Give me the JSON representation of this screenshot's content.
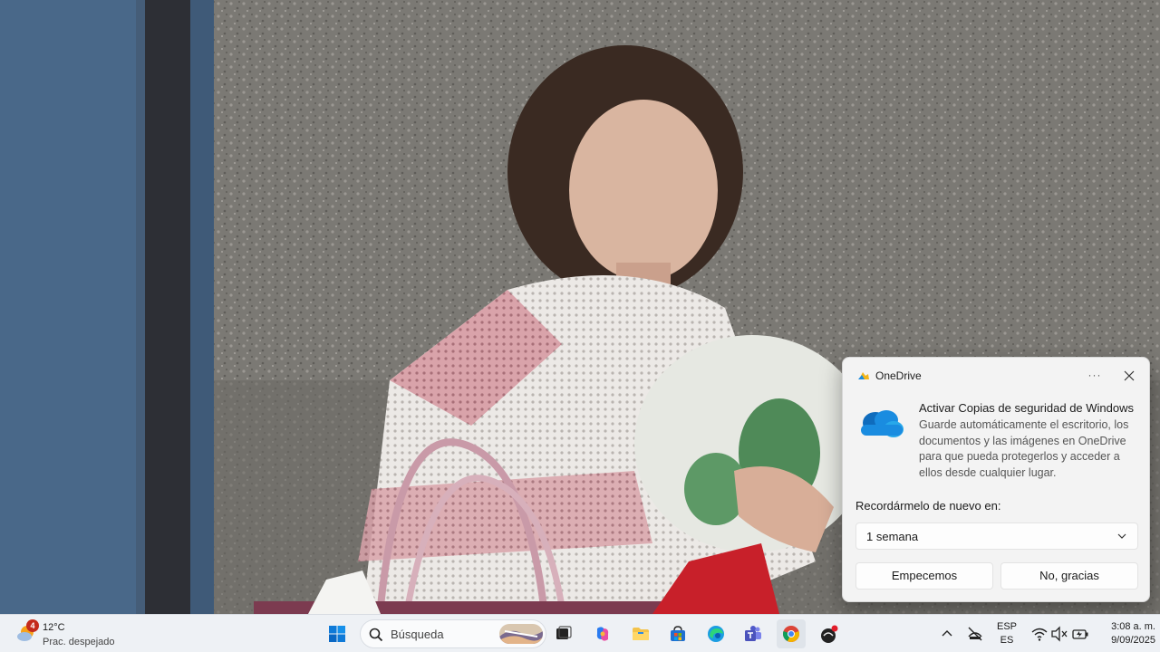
{
  "toast": {
    "app_name": "OneDrive",
    "more_label": "···",
    "title": "Activar Copias de seguridad de Windows",
    "body": "Guarde automáticamente el escritorio, los documentos y las imágenes en OneDrive para que pueda protegerlos y acceder a ellos desde cualquier lugar.",
    "remind_label": "Recordármelo de nuevo en:",
    "remind_value": "1 semana",
    "primary_button": "Empecemos",
    "secondary_button": "No, gracias"
  },
  "taskbar": {
    "weather": {
      "badge": "4",
      "temperature": "12°C",
      "condition": "Prac. despejado"
    },
    "search_placeholder": "Búsqueda",
    "pinned_icons": [
      "windows-start-icon",
      "task-view-icon",
      "copilot-icon",
      "file-explorer-icon",
      "microsoft-store-icon",
      "edge-icon",
      "teams-icon",
      "chrome-icon",
      "app-icon"
    ],
    "tray": {
      "language_line1": "ESP",
      "language_line2": "ES",
      "time": "3:08 a. m.",
      "date": "9/09/2025"
    }
  },
  "colors": {
    "accent_blue": "#0f6cbd",
    "onedrive_blue": "#1a8ce0",
    "taskbar_bg": "#eef1f5",
    "toast_bg": "#f3f3f3",
    "notification_red": "#c42b1c"
  }
}
